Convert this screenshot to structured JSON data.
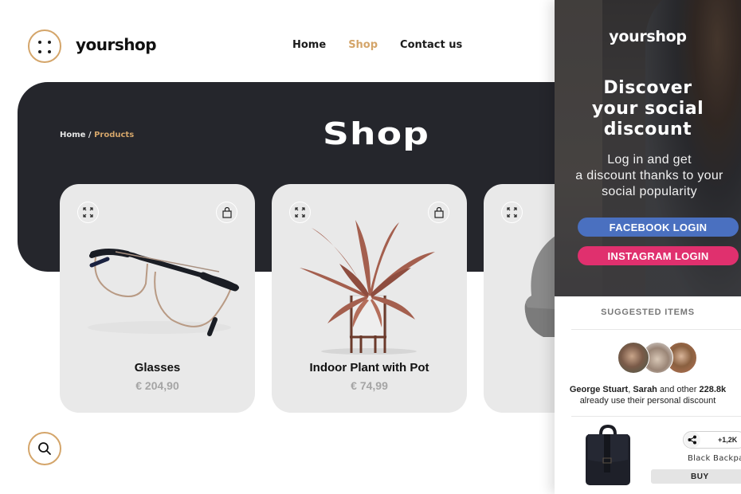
{
  "header": {
    "brand": "yourshop",
    "logo_icon": "four-dots-menu-icon",
    "nav": [
      {
        "label": "Home",
        "active": false
      },
      {
        "label": "Shop",
        "active": true
      },
      {
        "label": "Contact us",
        "active": false
      }
    ]
  },
  "hero": {
    "breadcrumb": {
      "home": "Home",
      "separator": " / ",
      "current": "Products"
    },
    "title": "Shop"
  },
  "products": [
    {
      "name": "Glasses",
      "price": "€ 204,90",
      "image": "eyeglasses",
      "icons": [
        "expand-icon",
        "shopping-bag-icon"
      ]
    },
    {
      "name": "Indoor Plant with Pot",
      "price": "€ 74,99",
      "image": "potted-plant",
      "icons": [
        "expand-icon",
        "shopping-bag-icon"
      ]
    },
    {
      "name": "",
      "price": "",
      "image": "grey-beanie",
      "icons": [
        "expand-icon"
      ]
    }
  ],
  "search": {
    "icon": "search-icon"
  },
  "panel": {
    "brand": "yourshop",
    "title_lines": [
      "Discover",
      "your social",
      "discount"
    ],
    "subtitle_lines": [
      "Log in and get",
      "a discount thanks to your",
      "social popularity"
    ],
    "facebook_label": "FACEBOOK LOGIN",
    "instagram_label": "INSTAGRAM LOGIN",
    "suggested_title": "SUGGESTED ITEMS",
    "social_proof": {
      "name1": "George Stuart",
      "sep": ", ",
      "name2": "Sarah",
      "mid": " and other ",
      "count": "228.8k",
      "line2": "already use their personal discount"
    },
    "item": {
      "name": "Black Backpack",
      "shares": "+1,2K",
      "buy_label": "BUY"
    }
  },
  "colors": {
    "accent": "#d4a56a",
    "dark": "#25262c",
    "facebook": "#4a70c0",
    "instagram": "#e0306e",
    "card": "#e9e9e9"
  }
}
